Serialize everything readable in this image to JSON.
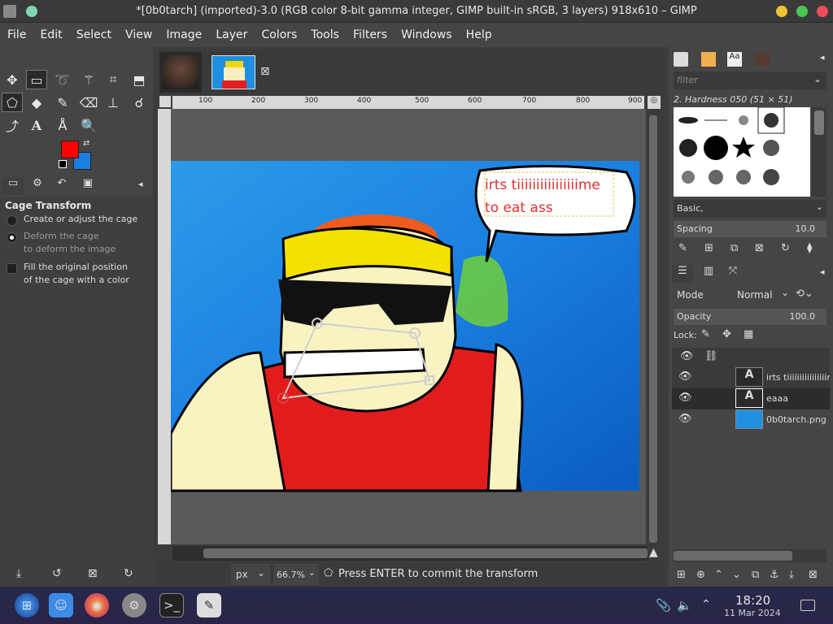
{
  "window": {
    "title": "*[0b0tarch] (imported)-3.0 (RGB color 8-bit gamma integer, GIMP built-in sRGB, 3 layers) 918x610 – GIMP"
  },
  "menu": [
    "File",
    "Edit",
    "Select",
    "View",
    "Image",
    "Layer",
    "Colors",
    "Tools",
    "Filters",
    "Windows",
    "Help"
  ],
  "colors": {
    "foreground": "#ff0000",
    "background": "#1a7fe0"
  },
  "tool_options": {
    "title": "Cage Transform",
    "options": [
      {
        "line1": "Create or adjust the cage",
        "line2": "",
        "selected": false
      },
      {
        "line1": "Deform the cage",
        "line2": "to deform the image",
        "selected": true
      }
    ],
    "checkbox": {
      "line1": "Fill the original position",
      "line2": "of the cage with a color"
    }
  },
  "canvas": {
    "ruler_ticks": [
      "100",
      "200",
      "300",
      "400",
      "500",
      "600",
      "700",
      "800",
      "900"
    ],
    "speech_bubble_line1": "irts tiiiiiiiiiiiiiiiime",
    "speech_bubble_line2": "to eat ass"
  },
  "status": {
    "unit": "px",
    "zoom": "66.7%",
    "message": "Press ENTER to commit the transform"
  },
  "brushes": {
    "filter_placeholder": "filter",
    "current": "2. Hardness 050 (51 × 51)",
    "preset": "Basic,",
    "spacing_label": "Spacing",
    "spacing_value": "10.0"
  },
  "layers": {
    "mode_label": "Mode",
    "mode_value": "Normal",
    "opacity_label": "Opacity",
    "opacity_value": "100.0",
    "lock_label": "Lock:",
    "items": [
      {
        "name": "irts tiiiiiiiiiiiiiiiime",
        "type": "text"
      },
      {
        "name": "eaaa",
        "type": "text"
      },
      {
        "name": "0b0tarch.png",
        "type": "image"
      }
    ]
  },
  "taskbar": {
    "time": "18:20",
    "date": "11 Mar 2024"
  }
}
